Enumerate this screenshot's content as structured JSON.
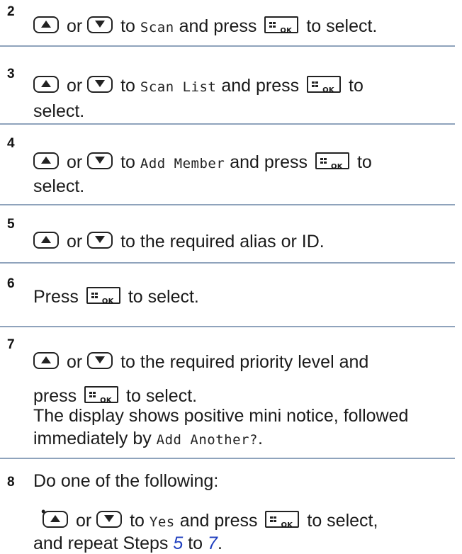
{
  "steps": [
    {
      "num": "2",
      "lines": [
        [
          "Scan",
          " and press ",
          " to select."
        ]
      ],
      "pre": " or ",
      "to": " to "
    },
    {
      "num": "3",
      "menu": "Scan List",
      "end": "to",
      "cont": "select."
    },
    {
      "num": "4",
      "menu": "Add Member",
      "end": "to",
      "cont": "select."
    },
    {
      "num": "5",
      "text": " to the required alias or ID."
    },
    {
      "num": "6",
      "press": "Press",
      "after": " to select."
    },
    {
      "num": "7",
      "text": " to the required priority level and",
      "press": "press",
      "after": " to select.",
      "desc1": "The display shows positive mini notice, followed",
      "desc2_pre": "immediately by ",
      "desc2_menu": "Add Another?",
      "desc2_post": "."
    },
    {
      "num": "8",
      "text": "Do one of the following:"
    }
  ],
  "words": {
    "or": "or",
    "to": "to",
    "and_press": "and press",
    "to_select": "to select.",
    "to_select_comma": "to select,",
    "scan": "Scan",
    "yes": "Yes",
    "repeat_pre": "and repeat Steps ",
    "step5": "5",
    "to_mid": " to ",
    "step7": "7",
    "period": ".",
    "bullet": "•",
    "ok": "OK"
  },
  "icons": {
    "up": "up-arrow-button-icon",
    "down": "down-arrow-button-icon",
    "ok": "menu-ok-button-icon"
  },
  "colors": {
    "rule": "#8fa3bc",
    "link": "#1f3fbf"
  }
}
